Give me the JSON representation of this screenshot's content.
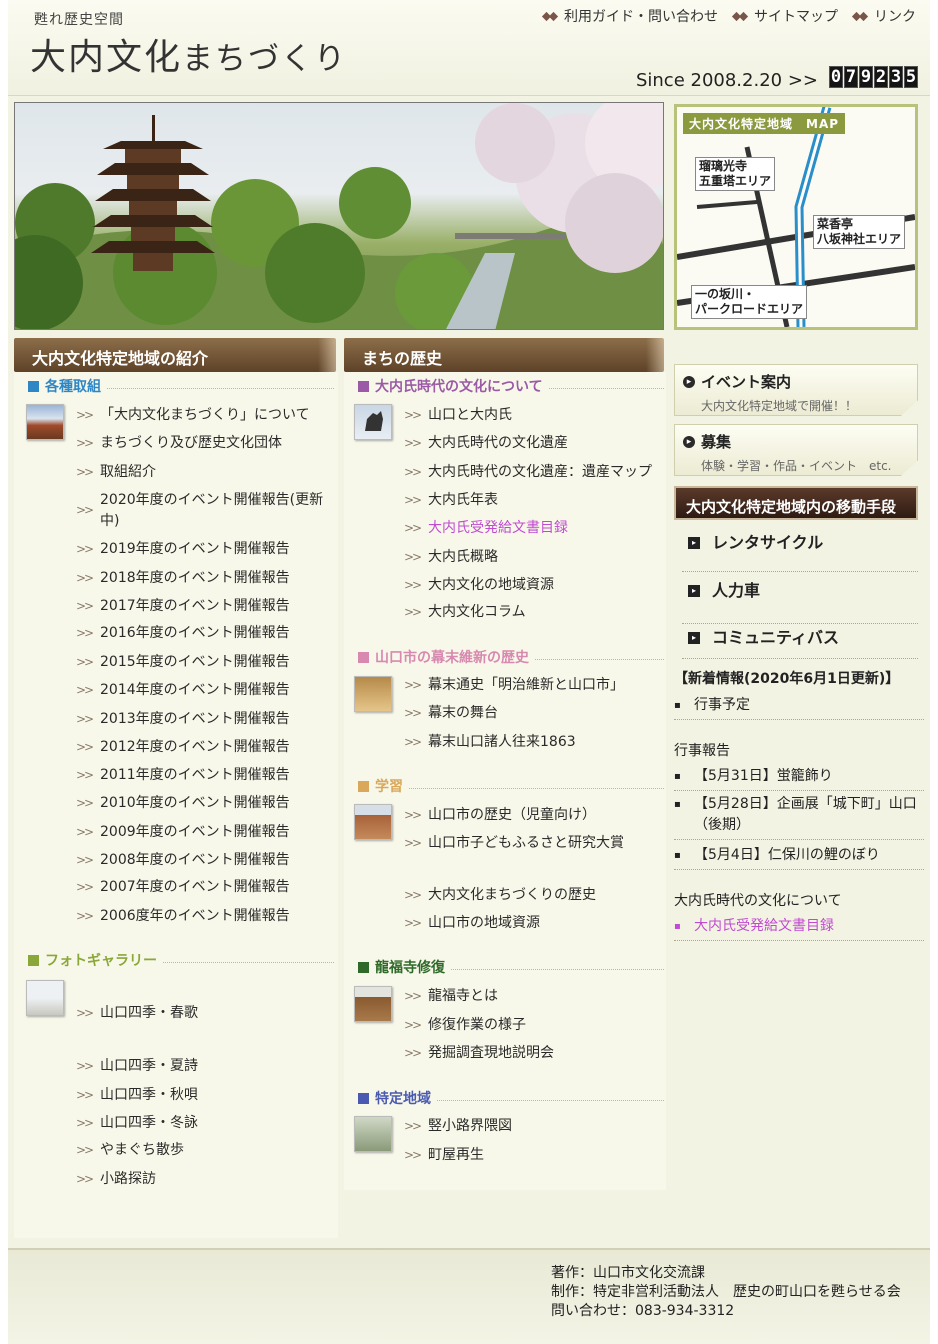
{
  "header": {
    "tagline": "甦れ歴史空間",
    "title_kanji": "大内文化",
    "title_kana": "まちづくり",
    "nav": [
      "利用ガイド・問い合わせ",
      "サイトマップ",
      "リンク"
    ],
    "since": "Since 2008.2.20 >>",
    "counter": [
      "0",
      "7",
      "9",
      "2",
      "3",
      "5"
    ]
  },
  "map": {
    "title": "大内文化特定地域　MAP",
    "areas": [
      "瑠璃光寺\n五重塔エリア",
      "菜香亭\n八坂神社エリア",
      "一の坂川・\nパークロードエリア"
    ]
  },
  "left": {
    "heading": "大内文化特定地域の紹介",
    "section1": "各種取組",
    "section1_links": [
      "「大内文化まちづくり」について",
      "まちづくり及び歴史文化団体",
      "取組紹介",
      "2020年度のイベント開催報告(更新中)",
      "2019年度のイベント開催報告",
      "2018年度のイベント開催報告",
      "2017年度のイベント開催報告",
      "2016年度のイベント開催報告",
      "2015年度のイベント開催報告",
      "2014年度のイベント開催報告",
      "2013年度のイベント開催報告",
      "2012年度のイベント開催報告",
      "2011年度のイベント開催報告",
      "2010年度のイベント開催報告",
      "2009年度のイベント開催報告",
      "2008年度のイベント開催報告",
      "2007年度のイベント開催報告",
      "2006度年のイベント開催報告"
    ],
    "section2": "フォトギャラリー",
    "section2_links": [
      "山口四季・春歌",
      "山口四季・夏詩",
      "山口四季・秋唄",
      "山口四季・冬詠",
      "やまぐち散歩",
      "小路探訪"
    ]
  },
  "center": {
    "heading": "まちの歴史",
    "sec_ouchi": "大内氏時代の文化について",
    "ouchi_links": [
      "山口と大内氏",
      "大内氏時代の文化遺産",
      "大内氏時代の文化遺産：遺産マップ",
      "大内氏年表",
      "大内氏受発給文書目録",
      "大内氏概略",
      "大内文化の地域資源",
      "大内文化コラム"
    ],
    "sec_bakumatsu": "山口市の幕末維新の歴史",
    "bakumatsu_links": [
      "幕末通史「明治維新と山口市」",
      "幕末の舞台",
      "幕末山口諸人往来1863"
    ],
    "sec_gakushu": "学習",
    "gakushu_links": [
      "山口市の歴史（児童向け）",
      "山口市子どもふるさと研究大賞",
      "大内文化まちづくりの歴史",
      "山口市の地域資源"
    ],
    "sec_ryufuku": "龍福寺修復",
    "ryufuku_links": [
      "龍福寺とは",
      "修復作業の様子",
      "発掘調査現地説明会"
    ],
    "sec_tokutei": "特定地域",
    "tokutei_links": [
      "竪小路界隈図",
      "町屋再生"
    ]
  },
  "right": {
    "event_title": "イベント案内",
    "event_sub": "大内文化特定地域で開催！！",
    "boshu_title": "募集",
    "boshu_sub": "体験・学習・作品・イベント　etc.",
    "transport_head": "大内文化特定地域内の移動手段",
    "transport_links": [
      "レンタサイクル",
      "人力車",
      "コミュニティバス"
    ],
    "news_head": "【新着情報(2020年6月1日更新)】",
    "news1": "行事予定",
    "report_head": "行事報告",
    "reports": [
      "【5月31日】蛍籠飾り",
      "【5月28日】企画展「城下町」山口（後期）",
      "【5月4日】仁保川の鯉のぼり"
    ],
    "culture_head": "大内氏時代の文化について",
    "culture_link": "大内氏受発給文書目録"
  },
  "footer": {
    "line1": "著作：山口市文化交流課",
    "line2": "制作：特定非営利活動法人　歴史の町山口を甦らせる会",
    "line3": "問い合わせ：083-934-3312"
  }
}
